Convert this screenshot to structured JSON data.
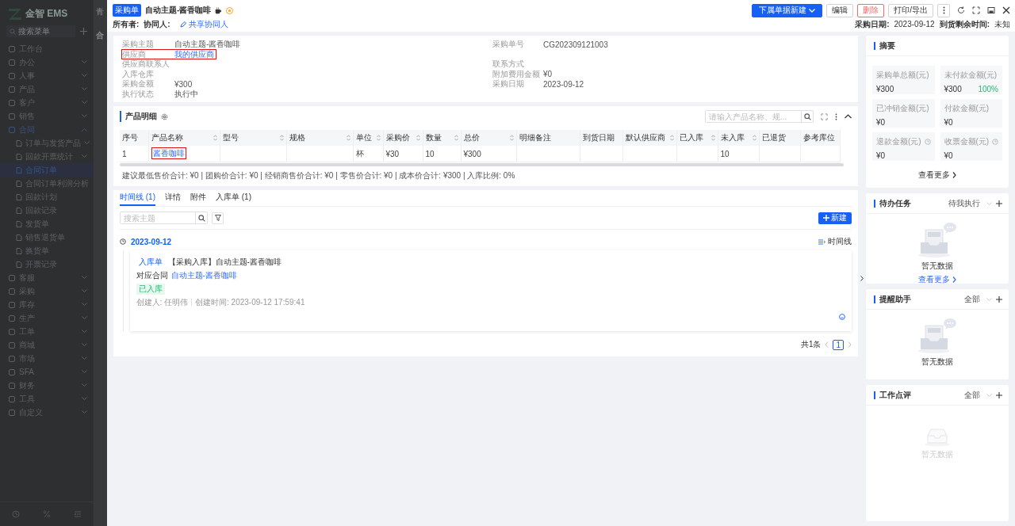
{
  "sidebar": {
    "logo": "金智 EMS",
    "search": {
      "placeholder": "搜索菜单"
    },
    "items": [
      {
        "label": "工作台",
        "selected": false
      },
      {
        "label": "办公",
        "selected": false,
        "expanded": false
      },
      {
        "label": "人事",
        "selected": false,
        "expanded": false
      },
      {
        "label": "产品",
        "selected": false,
        "expanded": false
      },
      {
        "label": "客户",
        "selected": false,
        "expanded": false
      },
      {
        "label": "销售",
        "selected": false,
        "expanded": false
      },
      {
        "label": "合同",
        "selected": false,
        "expanded": true,
        "children": [
          {
            "label": "订单与发货产品",
            "selected": false,
            "expanded": false
          },
          {
            "label": "回款开票统计",
            "selected": false,
            "expanded": false
          },
          {
            "label": "合同订单",
            "selected": true
          },
          {
            "label": "合同订单利润分析",
            "selected": false
          },
          {
            "label": "回款计划",
            "selected": false
          },
          {
            "label": "回款记录",
            "selected": false
          },
          {
            "label": "发货单",
            "selected": false
          },
          {
            "label": "销售退货单",
            "selected": false
          },
          {
            "label": "换货单",
            "selected": false
          },
          {
            "label": "开票记录",
            "selected": false
          }
        ]
      },
      {
        "label": "客服",
        "selected": false,
        "expanded": false
      },
      {
        "label": "采购",
        "selected": false,
        "expanded": false
      },
      {
        "label": "库存",
        "selected": false,
        "expanded": false
      },
      {
        "label": "生产",
        "selected": false,
        "expanded": false
      },
      {
        "label": "工单",
        "selected": false,
        "expanded": false
      },
      {
        "label": "商城",
        "selected": false,
        "expanded": false
      },
      {
        "label": "市场",
        "selected": false,
        "expanded": false
      },
      {
        "label": "SFA",
        "selected": false,
        "expanded": false
      },
      {
        "label": "财务",
        "selected": false,
        "expanded": false
      },
      {
        "label": "工具",
        "selected": false,
        "expanded": false
      },
      {
        "label": "自定义",
        "selected": false,
        "expanded": false
      }
    ]
  },
  "background": {
    "title": "青",
    "tab": "合"
  },
  "header": {
    "badge": "采购单",
    "title": "自动主题-酱香咖啡",
    "buttons": [
      {
        "label": "下属单据新建",
        "kind": "primary"
      },
      {
        "label": "编辑",
        "kind": "default"
      },
      {
        "label": "删除",
        "kind": "danger"
      },
      {
        "label": "打印/导出",
        "kind": "default"
      }
    ],
    "owner_label": "所有者:",
    "collaborator_label": "协同人:",
    "share_link": "共享协同人",
    "date_label": "采购日期:",
    "date": "2023-09-12",
    "remaining_label": "到货剩余时间:",
    "remaining": "未知"
  },
  "info": {
    "rows": [
      {
        "left": {
          "label": "采购主题",
          "value": "自动主题-酱香咖啡",
          "highlighted": false
        },
        "right": {
          "label": "采购单号",
          "value": "CG202309121003"
        }
      },
      {
        "left": {
          "label": "供应商",
          "value": "我的供应商",
          "kind": "link",
          "highlighted": true
        }
      },
      {
        "left": {
          "label": "供应商联系人",
          "highlighted": false
        },
        "right": {
          "label": "联系方式"
        }
      },
      {
        "left": {
          "label": "入库仓库",
          "highlighted": false
        },
        "right": {
          "label": "附加费用金额",
          "value": "¥0"
        }
      },
      {
        "left": {
          "label": "采购金额",
          "value": "¥300",
          "highlighted": false
        },
        "right": {
          "label": "采购日期",
          "value": "2023-09-12"
        }
      },
      {
        "left": {
          "label": "执行状态",
          "value": "执行中",
          "highlighted": false
        }
      }
    ]
  },
  "products": {
    "title": "产品明细",
    "search": {
      "placeholder": "请输入产品名称、规..."
    },
    "columns": [
      {
        "label": "序号",
        "sortable": false
      },
      {
        "label": "产品名称",
        "sortable": true
      },
      {
        "label": "型号",
        "sortable": true
      },
      {
        "label": "规格",
        "sortable": true
      },
      {
        "label": "单位",
        "sortable": true
      },
      {
        "label": "采购价",
        "sortable": true
      },
      {
        "label": "数量",
        "sortable": true
      },
      {
        "label": "总价",
        "sortable": true
      },
      {
        "label": "明细备注",
        "sortable": false
      },
      {
        "label": "到货日期",
        "sortable": false
      },
      {
        "label": "默认供应商",
        "sortable": true
      },
      {
        "label": "已入库",
        "sortable": true
      },
      {
        "label": "未入库",
        "sortable": true
      },
      {
        "label": "已退货",
        "sortable": false
      },
      {
        "label": "参考库位",
        "sortable": false
      }
    ],
    "rows": [
      {
        "cells": [
          {
            "text": "1"
          },
          {
            "text": "酱香咖啡",
            "kind": "link",
            "highlighted": true
          },
          {},
          {},
          {
            "text": "杯"
          },
          {
            "text": "¥30"
          },
          {
            "text": "10"
          },
          {
            "text": "¥300"
          },
          {},
          {},
          {},
          {},
          {
            "text": "10"
          },
          {},
          {}
        ]
      }
    ],
    "totals": "建议最低售价合计: ¥0 | 团购价合计: ¥0 | 经销商售价合计: ¥0 | 零售价合计: ¥0 | 成本价合计: ¥300 | 入库比例: 0%"
  },
  "timeline": {
    "tabs": [
      {
        "label": "时间线 (1)",
        "selected": true
      },
      {
        "label": "详情",
        "selected": false
      },
      {
        "label": "附件",
        "selected": false
      },
      {
        "label": "入库单 (1)",
        "selected": false
      }
    ],
    "search": {
      "placeholder": "搜索主题"
    },
    "new_button": "新建",
    "date": "2023-09-12",
    "view_label": "时间线",
    "event": {
      "tag": "入库单",
      "title": "【采购入库】自动主题-酱香咖啡",
      "contract_label": "对应合同",
      "contract_link": "自动主题-酱香咖啡",
      "status": "已入库",
      "creator": "创建人: 任明伟",
      "created": "创建时间: 2023-09-12 17:59:41"
    },
    "pagination": {
      "total": "共1条",
      "pages": [
        {
          "label": "1",
          "selected": true
        }
      ]
    }
  },
  "summary": {
    "title": "摘要",
    "tiles": [
      {
        "label": "采购单总额(元)",
        "value": "¥300",
        "clock": false
      },
      {
        "label": "未付款金额(元)",
        "value": "¥300",
        "percent": "100%",
        "clock": false
      },
      {
        "label": "已冲销金额(元)",
        "value": "¥0",
        "clock": false
      },
      {
        "label": "付款金额(元)",
        "value": "¥0",
        "clock": false
      },
      {
        "label": "退款金额(元)",
        "value": "¥0",
        "clock": true
      },
      {
        "label": "收票金额(元)",
        "value": "¥0",
        "clock": true
      }
    ],
    "more": "查看更多"
  },
  "panels": [
    {
      "title": "待办任务",
      "filter": "待我执行",
      "empty": "暂无数据",
      "more": "查看更多",
      "kind": "large"
    },
    {
      "title": "提醒助手",
      "filter": "全部",
      "empty": "暂无数据",
      "kind": "large"
    },
    {
      "title": "工作点评",
      "filter": "全部",
      "empty": "暂无数据",
      "kind": "faint"
    }
  ]
}
